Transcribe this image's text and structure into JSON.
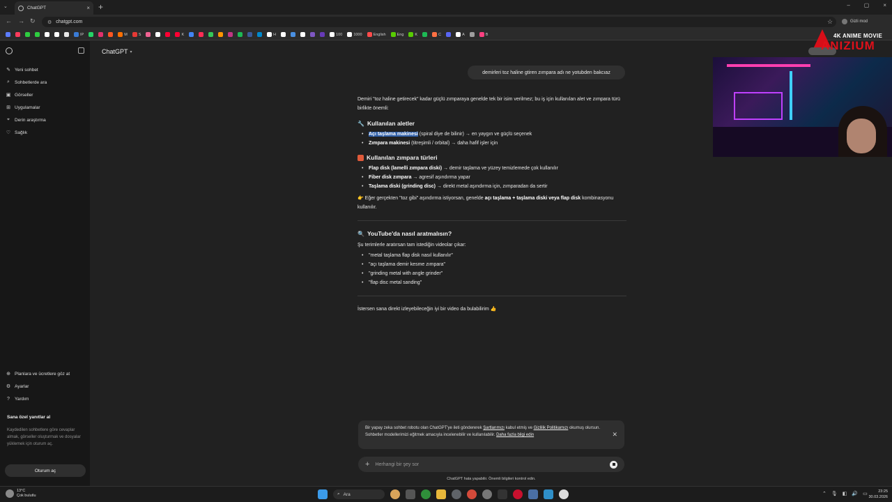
{
  "browser": {
    "tab_title": "ChatGPT",
    "url": "chatgpt.com",
    "incognito_label": "Gizli mod",
    "bookmarks": [
      {
        "label": "",
        "color": "#5b7cff"
      },
      {
        "label": "",
        "color": "#ff3b5c"
      },
      {
        "label": "",
        "color": "#2ecc40"
      },
      {
        "label": "",
        "color": "#2ecc40"
      },
      {
        "label": "",
        "color": "#ffffff"
      },
      {
        "label": "",
        "color": "#ffffff"
      },
      {
        "label": "",
        "color": "#e8e8e8"
      },
      {
        "label": "IP",
        "color": "#3a7bd5"
      },
      {
        "label": "",
        "color": "#25d366"
      },
      {
        "label": "",
        "color": "#e1306c"
      },
      {
        "label": "",
        "color": "#ff5722"
      },
      {
        "label": "M",
        "color": "#ff6f00"
      },
      {
        "label": "S",
        "color": "#e53935"
      },
      {
        "label": "",
        "color": "#f06292"
      },
      {
        "label": "",
        "color": "#ffffff"
      },
      {
        "label": "",
        "color": "#ff0033"
      },
      {
        "label": "K",
        "color": "#ff0033"
      },
      {
        "label": "",
        "color": "#4285f4"
      },
      {
        "label": "",
        "color": "#ff2d55"
      },
      {
        "label": "",
        "color": "#34c759"
      },
      {
        "label": "",
        "color": "#ff9500"
      },
      {
        "label": "",
        "color": "#c13584"
      },
      {
        "label": "",
        "color": "#1db954"
      },
      {
        "label": "",
        "color": "#3b5998"
      },
      {
        "label": "",
        "color": "#0088cc"
      },
      {
        "label": "H",
        "color": "#ffffff"
      },
      {
        "label": "",
        "color": "#ffffff"
      },
      {
        "label": "",
        "color": "#4a90e2"
      },
      {
        "label": "",
        "color": "#ffffff"
      },
      {
        "label": "",
        "color": "#7e57c2"
      },
      {
        "label": "",
        "color": "#673ab7"
      },
      {
        "label": "100",
        "color": "#ffffff"
      },
      {
        "label": "1000",
        "color": "#ffffff"
      },
      {
        "label": "English",
        "color": "#ff4b4b"
      },
      {
        "label": "Eng",
        "color": "#58cc02"
      },
      {
        "label": "K",
        "color": "#58cc02"
      },
      {
        "label": "",
        "color": "#1db954"
      },
      {
        "label": "C",
        "color": "#ff7043"
      },
      {
        "label": "",
        "color": "#5865f2"
      },
      {
        "label": "A",
        "color": "#ffffff"
      },
      {
        "label": "",
        "color": "#9e9e9e"
      },
      {
        "label": "B",
        "color": "#ff4081"
      }
    ]
  },
  "sidebar": {
    "items": [
      {
        "label": "Yeni sohbet",
        "icon": "edit-icon"
      },
      {
        "label": "Sohbetlerde ara",
        "icon": "search-icon"
      },
      {
        "label": "Görseller",
        "icon": "image-icon"
      },
      {
        "label": "Uygulamalar",
        "icon": "grid-icon"
      },
      {
        "label": "Derin araştırma",
        "icon": "telescope-icon"
      },
      {
        "label": "Sağlık",
        "icon": "heart-icon"
      }
    ],
    "bottom_items": [
      {
        "label": "Planlara ve ücretlere göz at",
        "icon": "plans-icon"
      },
      {
        "label": "Ayarlar",
        "icon": "gear-icon"
      },
      {
        "label": "Yardım",
        "icon": "help-icon"
      }
    ],
    "promo_title": "Sana özel yanıtlar al",
    "promo_text": "Kaydedilen sohbetlere göre cevaplar almak, görseller oluşturmak ve dosyalar yüklemek için oturum aç.",
    "login_label": "Oturum aç"
  },
  "header": {
    "model_label": "ChatGPT"
  },
  "conversation": {
    "user_message": "demirleri toz haline gtiren zımpara adı ne yotubden bakcıaz",
    "intro": "Demiri \"toz haline getirecek\" kadar güçlü zımparaya genelde tek bir isim verilmez; bu iş için kullanılan alet ve zımpara türü birlikte önemli:",
    "tools_heading": "Kullanılan aletler",
    "tools": [
      {
        "bold": "Açı taşlama makinesi",
        "rest": " (spiral diye de bilinir) → en yaygın ve güçlü seçenek"
      },
      {
        "bold": "Zımpara makinesi",
        "rest": " (titreşimli / orbital) → daha hafif işler için"
      }
    ],
    "types_heading": "Kullanılan zımpara türleri",
    "types": [
      {
        "bold": "Flap disk (lamelli zımpara diski)",
        "rest": " → demir taşlama ve yüzey temizlemede çok kullanılır"
      },
      {
        "bold": "Fiber disk zımpara",
        "rest": " → agresif aşındırma yapar"
      },
      {
        "bold": "Taşlama diski (grinding disc)",
        "rest": " → direkt metal aşındırma için, zımparadan da sertir"
      }
    ],
    "tip_prefix": "Eğer gerçekten \"toz gibi\" aşındırma istiyorsan, genelde ",
    "tip_bold": "açı taşlama + taşlama diski veya flap disk",
    "tip_suffix": " kombinasyonu kullanılır.",
    "youtube_heading": "YouTube'da nasıl aratmalısın?",
    "youtube_intro": "Şu terimlerle aratırsan tam istediğin videolar çıkar:",
    "queries": [
      "\"metal taşlama flap disk nasıl kullanılır\"",
      "\"açı taşlama demir kesme zımpara\"",
      "\"grinding metal with angle grinder\"",
      "\"flap disc metal sanding\""
    ],
    "outro": "İstersen sana direkt izleyebileceğin iyi bir video da bulabilirim 👍"
  },
  "notice": {
    "text1": "Bir yapay zeka sohbet robotu olan ChatGPT'ye ileti göndererek ",
    "terms_link": "Şartlarımızı",
    "text2": " kabul etmiş ve ",
    "privacy_link": "Gizlilik Politikamızı",
    "text3": " okumuş olursun.",
    "text4": "Sohbetler modellerimizi eğitmek amacıyla incelenebilir ve kullanılabilir. ",
    "learn_link": "Daha fazla bilgi edin"
  },
  "composer": {
    "placeholder": "Herhangi bir şey sor",
    "disclaimer": "ChatGPT hata yapabilir. Önemli bilgileri kontrol edin."
  },
  "overlay": {
    "brand_line1": "4K ANIME MOVIE",
    "brand_line2": "ANIZIUM"
  },
  "taskbar": {
    "temperature": "13°C",
    "weather": "Çok bulutlu",
    "search_label": "Ara",
    "time": "23:25",
    "date": "30.03.2026"
  },
  "colors": {
    "accent_highlight": "#2f5fa8",
    "tools_emoji": "#9aa0a6",
    "types_emoji": "#e05a3a",
    "tip_emoji": "#f4c542",
    "search_emoji": "#4a90d9"
  }
}
